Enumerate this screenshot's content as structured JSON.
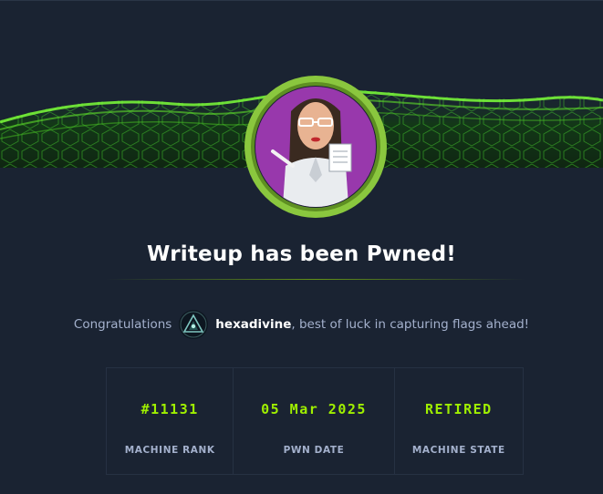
{
  "title": "Writeup has been Pwned!",
  "congrats": {
    "prefix": "Congratulations",
    "username": "hexadivine",
    "suffix": ", best of luck in capturing flags ahead!"
  },
  "stats": [
    {
      "value": "#11131",
      "label": "MACHINE RANK"
    },
    {
      "value": "05 Mar 2025",
      "label": "PWN DATE"
    },
    {
      "value": "RETIRED",
      "label": "MACHINE STATE"
    }
  ],
  "colors": {
    "background": "#1a2332",
    "accent": "#9fef00",
    "muted_text": "#a4b1cd",
    "avatar_ring": "#8ac73e"
  },
  "icons": {
    "banner": "green-hex-wave-banner",
    "machine_avatar": "machine-avatar-writeup",
    "user_avatar": "user-avatar-hexadivine"
  }
}
